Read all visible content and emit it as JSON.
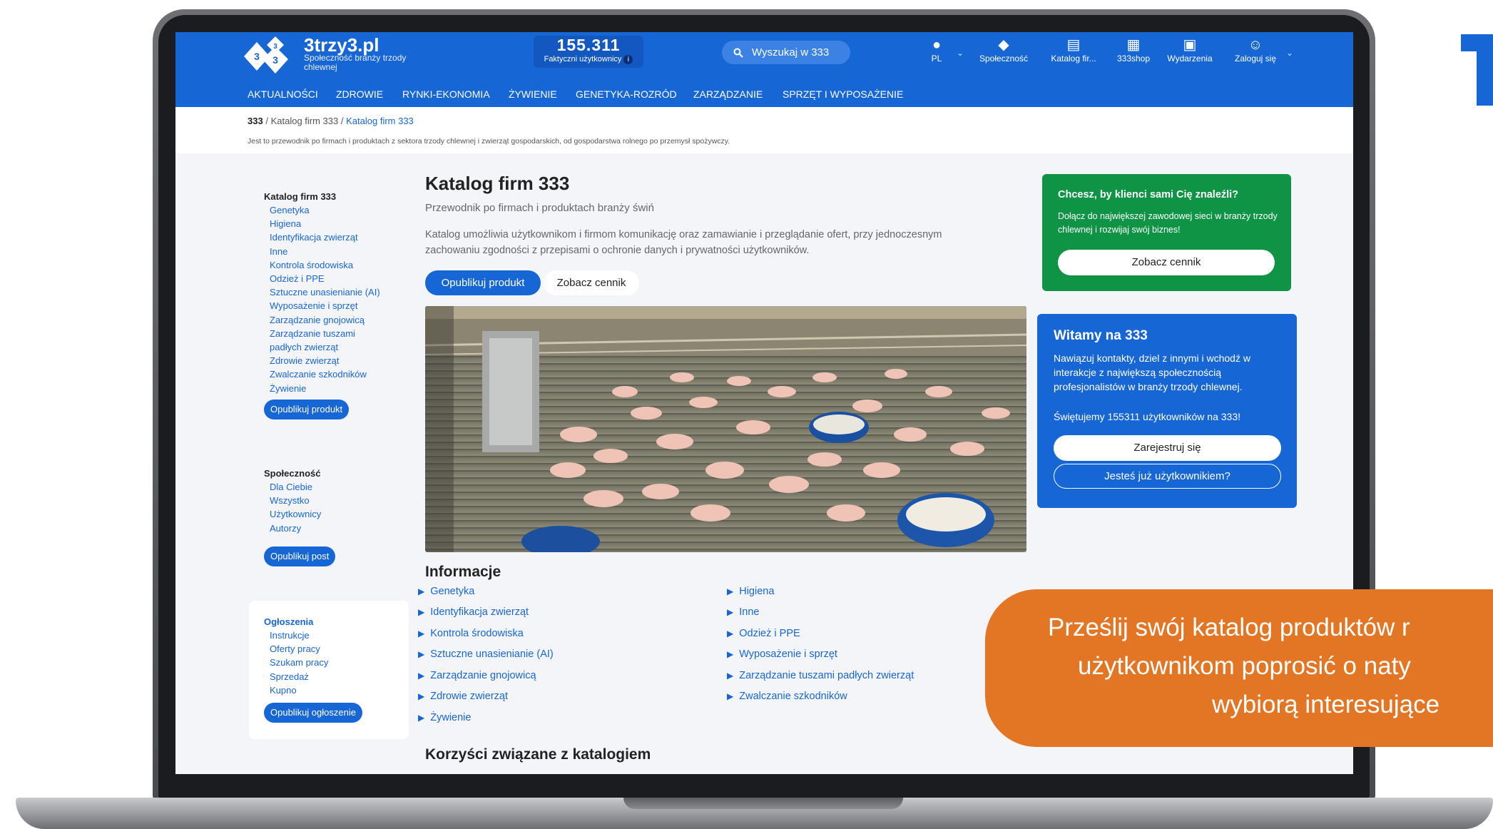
{
  "header": {
    "logo_name": "3trzy3.pl",
    "logo_tagline": "Społeczność branży trzody chlewnej",
    "counter_value": "155.311",
    "counter_label": "Faktyczni użytkownicy",
    "search_placeholder": "Wyszukaj w 333",
    "nav": [
      {
        "icon": "globe-icon",
        "label": "PL"
      },
      {
        "icon": "community-icon",
        "label": "Społeczność"
      },
      {
        "icon": "catalog-icon",
        "label": "Katalog fir..."
      },
      {
        "icon": "shop-icon",
        "label": "333shop"
      },
      {
        "icon": "calendar-icon",
        "label": "Wydarzenia"
      },
      {
        "icon": "user-icon",
        "label": "Zaloguj się"
      }
    ]
  },
  "menu": [
    "AKTUALNOŚCI",
    "ZDROWIE",
    "RYNKI-EKONOMIA",
    "ŻYWIENIE",
    "GENETYKA-ROZRÓD",
    "ZARZĄDZANIE",
    "SPRZĘT I WYPOSAŻENIE"
  ],
  "breadcrumb": {
    "root": "333",
    "level1": "Katalog firm 333",
    "current": "Katalog firm 333",
    "separator": "/"
  },
  "breadcrumb_description": "Jest to przewodnik po firmach i produktach z sektora trzody chlewnej i zwierząt gospodarskich, od gospodarstwa rolnego po przemysł spożywczy.",
  "sidebar": {
    "catalog_heading": "Katalog firm 333",
    "catalog_items": [
      "Genetyka",
      "Higiena",
      "Identyfikacja zwierząt",
      "Inne",
      "Kontrola środowiska",
      "Odzież i PPE",
      "Sztuczne unasienianie (AI)",
      "Wyposażenie i sprzęt",
      "Zarządzanie gnojowicą",
      "Zarządzanie tuszami",
      "padłych zwierząt",
      "Zdrowie zwierząt",
      "Zwalczanie szkodników",
      "Żywienie"
    ],
    "catalog_button": "Opublikuj produkt",
    "community_heading": "Społeczność",
    "community_items": [
      "Dla Ciebie",
      "Wszystko",
      "Użytkownicy",
      "Autorzy"
    ],
    "community_button": "Opublikuj post",
    "ads_heading": "Ogłoszenia",
    "ads_items": [
      "Instrukcje",
      "Oferty pracy",
      "Szukam pracy",
      "Sprzedaż",
      "Kupno"
    ],
    "ads_button": "Opublikuj ogłoszenie"
  },
  "main": {
    "title": "Katalog firm 333",
    "subtitle": "Przewodnik po firmach i produktach branży świń",
    "description": "Katalog umożliwia użytkownikom i firmom komunikację oraz zamawianie i przeglądanie ofert, przy jednoczesnym zachowaniu zgodności z przepisami o ochronie danych i prywatności użytkowników.",
    "publish_button": "Opublikuj produkt",
    "pricing_button": "Zobacz cennik",
    "info_heading": "Informacje",
    "info_left": [
      "Genetyka",
      "Identyfikacja zwierząt",
      "Kontrola środowiska",
      "Sztuczne unasienianie (AI)",
      "Zarządzanie gnojowicą",
      "Zdrowie zwierząt",
      "Żywienie"
    ],
    "info_right": [
      "Higiena",
      "Inne",
      "Odzież i PPE",
      "Wyposażenie i sprzęt",
      "Zarządzanie tuszami padłych zwierząt",
      "Zwalczanie szkodników"
    ],
    "benefits_heading": "Korzyści związane z katalogiem"
  },
  "green_card": {
    "title": "Chcesz, by klienci sami Cię znaleźli?",
    "text": "Dołącz do największej zawodowej sieci w branży trzody chlewnej i rozwijaj swój biznes!",
    "button": "Zobacz cennik"
  },
  "blue_card": {
    "title": "Witamy na 333",
    "text": "Nawiązuj kontakty, dziel z innymi i wchodź w interakcje z największą społecznością profesjonalistów w branży trzody chlewnej.",
    "celebrate": "Świętujemy 155311 użytkowników na 333!",
    "register_button": "Zarejestruj się",
    "login_button": "Jesteś już użytkownikiem?"
  },
  "overlay": {
    "line1": "Prześlij swój katalog produktów r",
    "line2": "użytkownikom poprosić o naty",
    "line3": "wybiorą interesujące"
  },
  "colors": {
    "brand_blue": "#1766d6",
    "green": "#0f9446",
    "orange": "#e27624"
  }
}
